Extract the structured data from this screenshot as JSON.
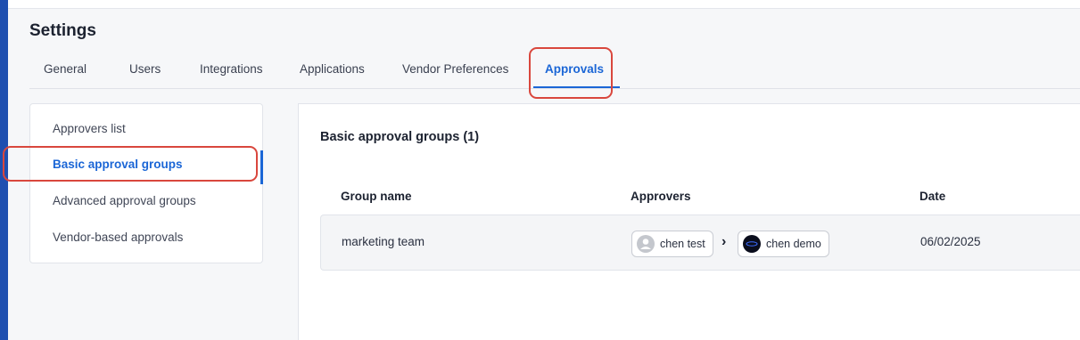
{
  "page": {
    "title": "Settings"
  },
  "tabs": [
    {
      "label": "General"
    },
    {
      "label": "Users"
    },
    {
      "label": "Integrations"
    },
    {
      "label": "Applications"
    },
    {
      "label": "Vendor Preferences"
    },
    {
      "label": "Approvals",
      "active": true
    }
  ],
  "sidebar": {
    "items": [
      {
        "label": "Approvers list"
      },
      {
        "label": "Basic approval groups",
        "active": true
      },
      {
        "label": "Advanced approval groups"
      },
      {
        "label": "Vendor-based approvals"
      }
    ]
  },
  "main": {
    "section_title": "Basic approval groups (1)",
    "table": {
      "headers": [
        "Group name",
        "Approvers",
        "Date"
      ],
      "rows": [
        {
          "group_name": "marketing team",
          "approvers": [
            {
              "name": "chen test",
              "avatar": "person-icon"
            },
            {
              "name": "chen demo",
              "avatar": "company-logo"
            }
          ],
          "separator_icon": "chevron-right-icon",
          "date": "06/02/2025"
        }
      ]
    }
  },
  "colors": {
    "accent": "#1b66d6",
    "highlight": "#d9473d",
    "left_edge": "#1f4fb0"
  }
}
